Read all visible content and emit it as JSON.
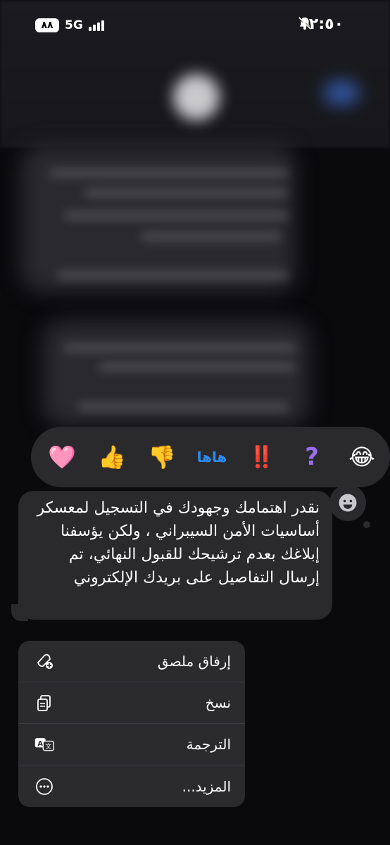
{
  "status_bar": {
    "time": "١٢:٥٠",
    "battery": "٨٨",
    "network": "5G"
  },
  "reactions": [
    {
      "name": "heart-reaction",
      "glyph": "🩷"
    },
    {
      "name": "thumbs-up-reaction",
      "glyph": "👍"
    },
    {
      "name": "thumbs-down-reaction",
      "glyph": "👎"
    },
    {
      "name": "haha-reaction",
      "glyph": "هاها"
    },
    {
      "name": "exclamation-reaction",
      "glyph": "‼️"
    },
    {
      "name": "question-reaction",
      "glyph": "?"
    },
    {
      "name": "laugh-reaction",
      "glyph": "😂"
    }
  ],
  "message": {
    "text": "نقدر اهتمامك وجهودك في التسجيل لمعسكر أساسيات الأمن السيبراني ، ولكن يؤسفنا إبلاغك بعدم ترشيحك للقبول النهائي، تم إرسال التفاصيل على بريدك الإلكتروني"
  },
  "menu": {
    "items": [
      {
        "label": "إرفاق ملصق",
        "icon": "sticker-add-icon"
      },
      {
        "label": "نسخ",
        "icon": "copy-icon"
      },
      {
        "label": "الترجمة",
        "icon": "translate-icon"
      },
      {
        "label": "المزيد...",
        "icon": "more-icon"
      }
    ]
  },
  "colors": {
    "bubble": "#2a2a2d",
    "menu": "#2b2b2e",
    "background": "#0a0a0d"
  }
}
